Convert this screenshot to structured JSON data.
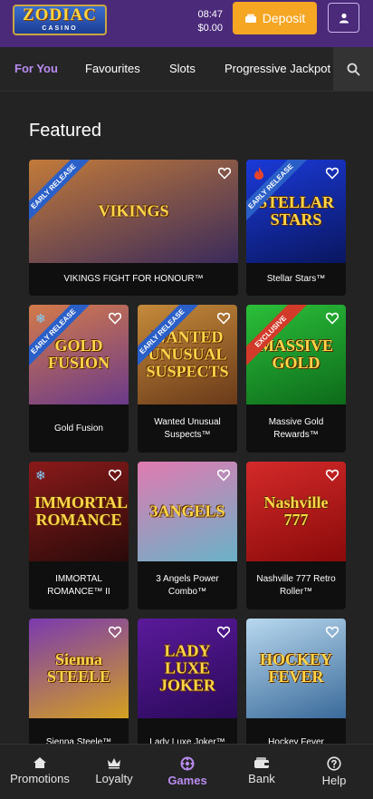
{
  "header": {
    "logo_main": "ZODIAC",
    "logo_sub": "CASINO",
    "time": "08:47",
    "balance": "$0.00",
    "deposit_label": "Deposit"
  },
  "tabs": [
    "For You",
    "Favourites",
    "Slots",
    "Progressive Jackpot"
  ],
  "active_tab": "For You",
  "section_title": "Featured",
  "games": [
    {
      "name": "VIKINGS FIGHT FOR HONOUR™",
      "art": "VIKINGS",
      "badge": "EARLY RELEASE",
      "colors": [
        "#c27a3a",
        "#3a2a5a"
      ]
    },
    {
      "name": "Stellar Stars™",
      "art": "STELLAR STARS",
      "badge": "EARLY RELEASE",
      "colors": [
        "#1a3ad8",
        "#0a1660"
      ]
    },
    {
      "name": "Gold Fusion",
      "art": "GOLD FUSION",
      "badge": "EARLY RELEASE",
      "colors": [
        "#d37a4a",
        "#6a3a8a"
      ]
    },
    {
      "name": "Wanted Unusual Suspects™",
      "art": "WANTED UNUSUAL SUSPECTS",
      "badge": "EARLY RELEASE",
      "colors": [
        "#c58a3a",
        "#6a3a1a"
      ]
    },
    {
      "name": "Massive Gold Rewards™",
      "art": "MASSIVE GOLD",
      "badge": "EXCLUSIVE",
      "colors": [
        "#2bbf3a",
        "#0d6a1a"
      ]
    },
    {
      "name": "IMMORTAL ROMANCE™ II",
      "art": "IMMORTAL ROMANCE",
      "badge": "",
      "colors": [
        "#8a1a1a",
        "#2a0a0a"
      ]
    },
    {
      "name": "3 Angels Power Combo™",
      "art": "3ANGELS",
      "badge": "",
      "colors": [
        "#e07ab0",
        "#6ab2c8"
      ]
    },
    {
      "name": "Nashville 777 Retro Roller™",
      "art": "Nashville 777",
      "badge": "",
      "colors": [
        "#d42a2a",
        "#8a0a0a"
      ]
    },
    {
      "name": "Sienna Steele™",
      "art": "Sienna STEELE",
      "badge": "",
      "colors": [
        "#7a3ab0",
        "#d4a020"
      ]
    },
    {
      "name": "Lady Luxe Joker™",
      "art": "LADY LUXE JOKER",
      "badge": "",
      "colors": [
        "#5a1a9a",
        "#2a0a5a"
      ]
    },
    {
      "name": "Hockey Fever",
      "art": "HOCKEY FEVER",
      "badge": "",
      "colors": [
        "#b8d8ee",
        "#3a6a9a"
      ]
    }
  ],
  "bottom_nav": [
    "Promotions",
    "Loyalty",
    "Games",
    "Bank",
    "Help"
  ],
  "active_nav": "Games",
  "colors": {
    "brand": "#4b2a7a",
    "accent": "#b98cf0",
    "deposit": "#f5a623"
  }
}
